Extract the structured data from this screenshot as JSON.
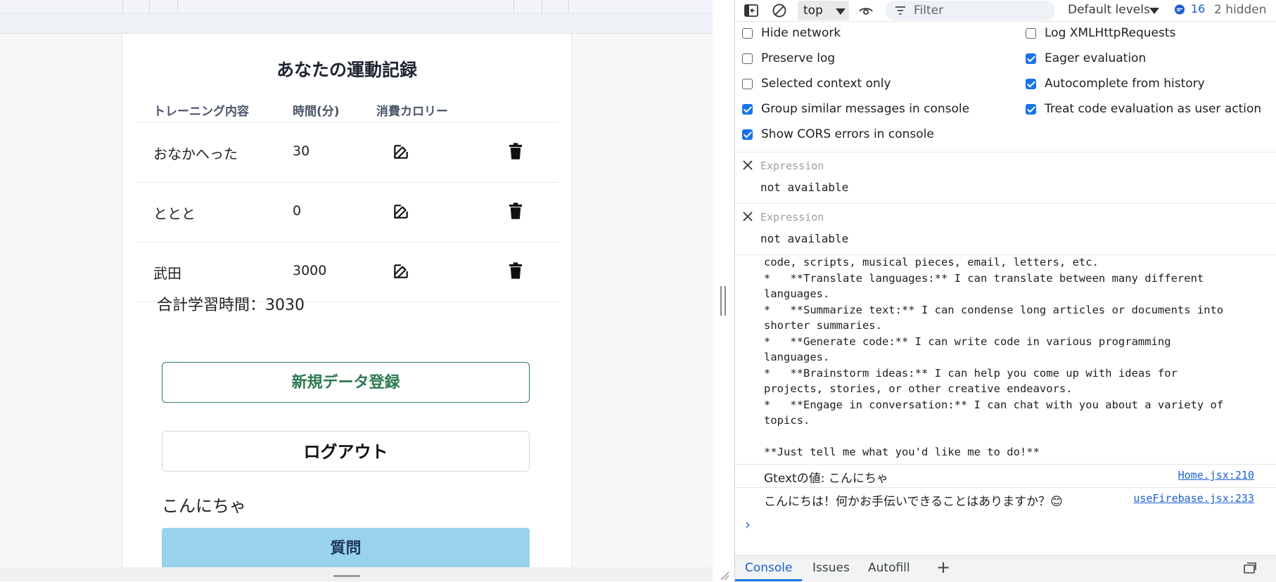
{
  "app": {
    "title": "あなたの運動記録",
    "columns": [
      "トレーニング内容",
      "時間(分)",
      "消費カロリー"
    ],
    "rows": [
      {
        "name": "おなかへった",
        "time": "30"
      },
      {
        "name": "ととと",
        "time": "0"
      },
      {
        "name": "武田",
        "time": "3000"
      }
    ],
    "total": "合計学習時間：3030",
    "new_button": "新規データ登録",
    "logout_button": "ログアウト",
    "greeting": "こんにちゃ",
    "ask_button": "質問"
  },
  "devtools": {
    "context": "top",
    "filter_placeholder": "Filter",
    "levels": "Default levels",
    "message_count": "16",
    "hidden": "2 hidden",
    "settings": [
      {
        "label": "Hide network",
        "checked": false
      },
      {
        "label": "Log XMLHttpRequests",
        "checked": false
      },
      {
        "label": "Preserve log",
        "checked": false
      },
      {
        "label": "Eager evaluation",
        "checked": true
      },
      {
        "label": "Selected context only",
        "checked": false
      },
      {
        "label": "Autocomplete from history",
        "checked": true
      },
      {
        "label": "Group similar messages in console",
        "checked": true
      },
      {
        "label": "Treat code evaluation as user action",
        "checked": true
      },
      {
        "label": "Show CORS errors in console",
        "checked": true
      }
    ],
    "expressions": [
      {
        "placeholder": "Expression",
        "value": "not available"
      },
      {
        "placeholder": "Expression",
        "value": "not available"
      }
    ],
    "console_message": "code, scripts, musical pieces, email, letters, etc.\n*   **Translate languages:** I can translate between many different\nlanguages.\n*   **Summarize text:** I can condense long articles or documents into\nshorter summaries.\n*   **Generate code:** I can write code in various programming\nlanguages.\n*   **Brainstorm ideas:** I can help you come up with ideas for\nprojects, stories, or other creative endeavors.\n*   **Engage in conversation:** I can chat with you about a variety of\ntopics.\n\n**Just tell me what you'd like me to do!**",
    "logs": [
      {
        "text": "Gtextの値: こんにちゃ",
        "source": "Home.jsx:210"
      },
      {
        "text": "こんにちは！何かお手伝いできることはありますか？😊",
        "source": "useFirebase.jsx:233"
      }
    ],
    "prompt": "›",
    "tabs": [
      "Console",
      "Issues",
      "Autofill"
    ],
    "add_tab": "+"
  },
  "icons": {
    "edit": "edit-icon",
    "delete": "trash-icon",
    "close": "close-icon",
    "filter": "filter-icon"
  },
  "colors": {
    "accent_green": "#2a7a50",
    "ask_button_bg": "#99d2eb",
    "checkbox_blue": "#1a73e8",
    "link_blue": "#1a5fd0"
  }
}
